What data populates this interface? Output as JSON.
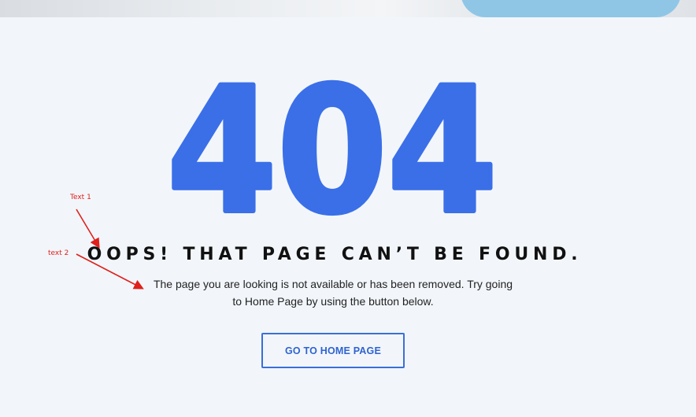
{
  "error_code": "404",
  "headline": "OOPS! THAT PAGE CAN’T BE FOUND.",
  "description": {
    "line1": "The page you are looking is not available or has been removed. Try going",
    "line2": "to Home Page by using the button below."
  },
  "button_label": "GO TO HOME PAGE",
  "annotations": {
    "label1": "Text 1",
    "label2": "text 2"
  },
  "colors": {
    "accent": "#3a6fe8",
    "background": "#f2f6fb",
    "annotation": "#e0201b"
  }
}
